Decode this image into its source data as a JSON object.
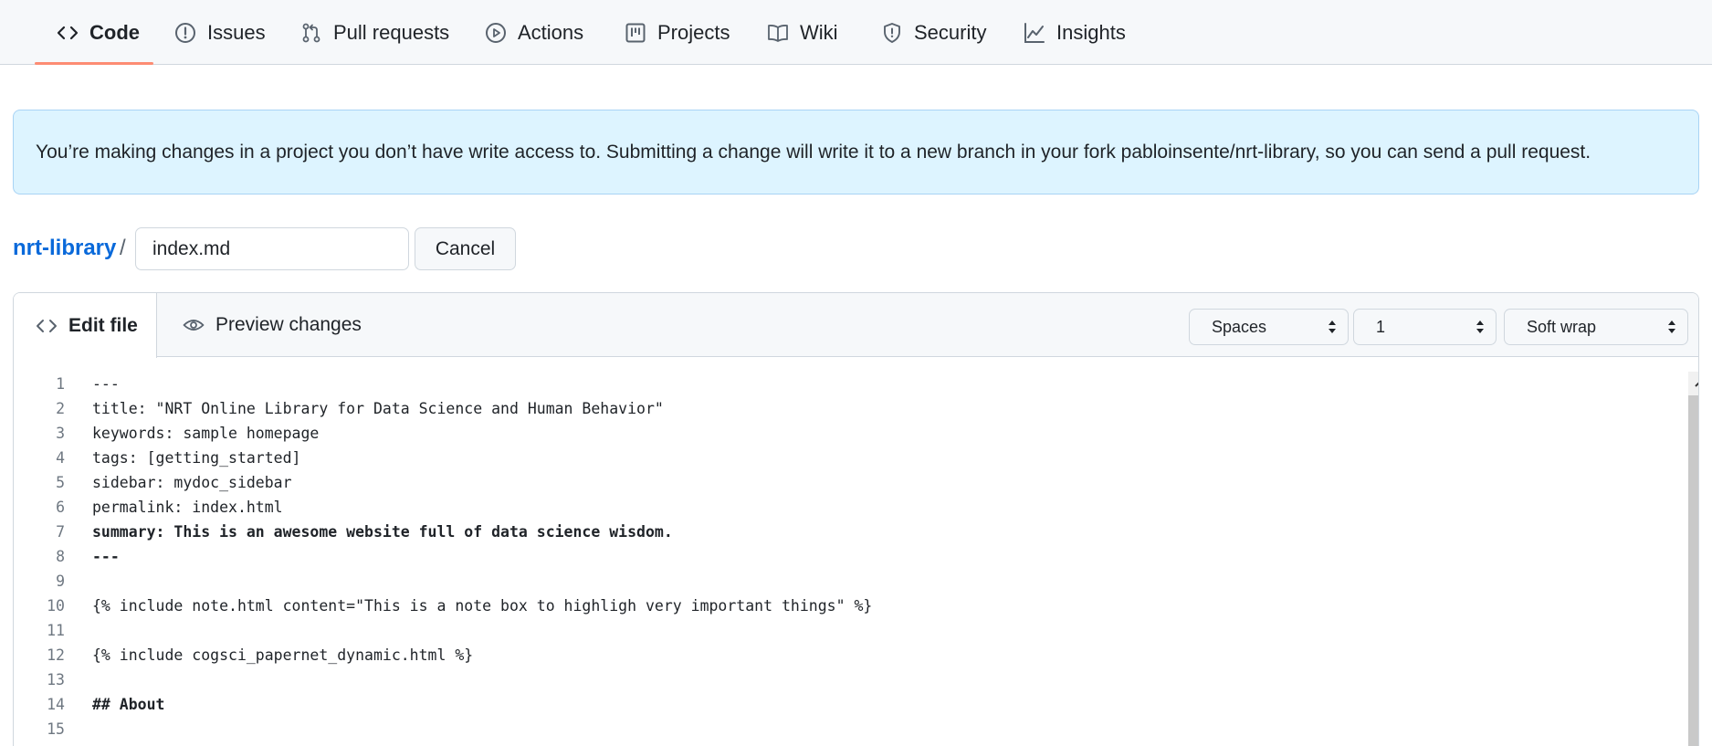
{
  "nav": {
    "tabs": [
      {
        "label": "Code",
        "icon": "code-icon",
        "active": true
      },
      {
        "label": "Issues",
        "icon": "issue-icon",
        "active": false
      },
      {
        "label": "Pull requests",
        "icon": "pull-request-icon",
        "active": false
      },
      {
        "label": "Actions",
        "icon": "play-icon",
        "active": false
      },
      {
        "label": "Projects",
        "icon": "project-board-icon",
        "active": false
      },
      {
        "label": "Wiki",
        "icon": "book-icon",
        "active": false
      },
      {
        "label": "Security",
        "icon": "shield-icon",
        "active": false
      },
      {
        "label": "Insights",
        "icon": "graph-icon",
        "active": false
      }
    ]
  },
  "flash": {
    "text": "You’re making changes in a project you don’t have write access to. Submitting a change will write it to a new branch in your fork pabloinsente/nrt-library, so you can send a pull request."
  },
  "breadcrumb": {
    "repo": "nrt-library",
    "separator": "/",
    "filename_value": "index.md",
    "cancel_label": "Cancel"
  },
  "editor": {
    "tabs": {
      "edit_label": "Edit file",
      "preview_label": "Preview changes"
    },
    "indent_mode": {
      "selected": "Spaces"
    },
    "indent_size": {
      "selected": "1"
    },
    "wrap_mode": {
      "selected": "Soft wrap"
    },
    "lines": [
      {
        "n": "1",
        "text": "---"
      },
      {
        "n": "2",
        "text": "title: \"NRT Online Library for Data Science and Human Behavior\""
      },
      {
        "n": "3",
        "text": "keywords: sample homepage"
      },
      {
        "n": "4",
        "text": "tags: [getting_started]"
      },
      {
        "n": "5",
        "text": "sidebar: mydoc_sidebar"
      },
      {
        "n": "6",
        "text": "permalink: index.html"
      },
      {
        "n": "7",
        "text": "summary: This is an awesome website full of data science wisdom."
      },
      {
        "n": "8",
        "text": "---"
      },
      {
        "n": "9",
        "text": ""
      },
      {
        "n": "10",
        "text": "{% include note.html content=\"This is a note box to highligh very important things\" %}"
      },
      {
        "n": "11",
        "text": ""
      },
      {
        "n": "12",
        "text": "{% include cogsci_papernet_dynamic.html %}"
      },
      {
        "n": "13",
        "text": ""
      },
      {
        "n": "14",
        "text": "## About"
      },
      {
        "n": "15",
        "text": ""
      }
    ]
  },
  "colors": {
    "accent_underline": "#fd8c73",
    "link": "#0969da",
    "flash_bg": "#ddf4ff"
  }
}
